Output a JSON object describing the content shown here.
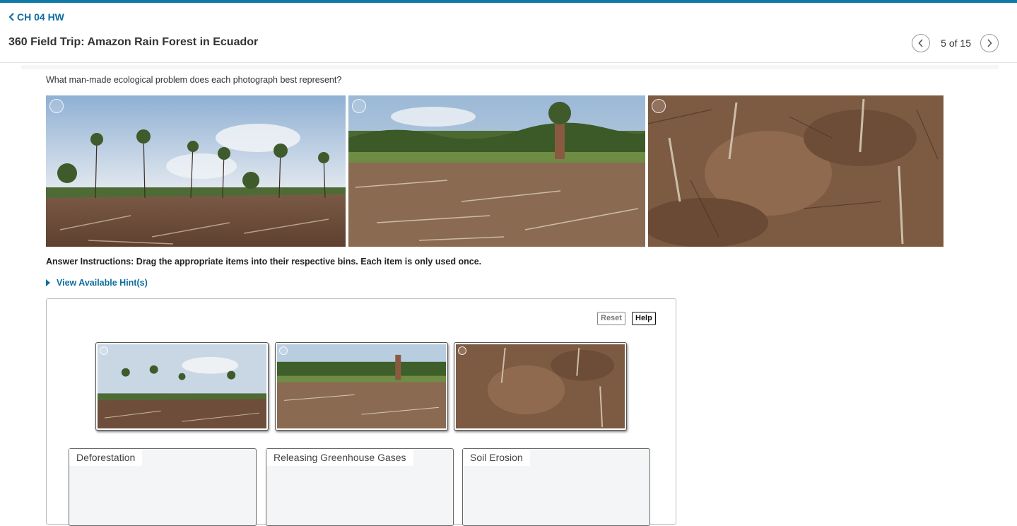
{
  "nav": {
    "back_label": "CH 04 HW",
    "back_icon": "chevron-left-icon"
  },
  "header": {
    "title": "360 Field Trip: Amazon Rain Forest in Ecuador",
    "counter": "5 of 15"
  },
  "question": "What man-made ecological problem does each photograph best represent?",
  "instructions": "Answer Instructions: Drag the appropriate items into their respective bins. Each item is only used once.",
  "hint_label": "View Available Hint(s)",
  "buttons": {
    "reset": "Reset",
    "help": "Help"
  },
  "bins": [
    "Deforestation",
    "Releasing Greenhouse Gases",
    "Soil Erosion"
  ],
  "colors": {
    "accent": "#0d6e9e",
    "topbar": "#0f7aa8",
    "soil": "#8a6448",
    "sky": "#b9cde0",
    "forest": "#4f6b35"
  }
}
